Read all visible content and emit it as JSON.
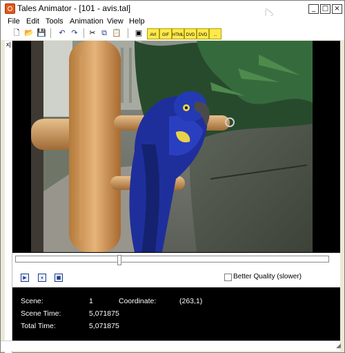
{
  "window": {
    "title": "Tales Animator - [101 - avis.tal]",
    "buttons": {
      "minimize": "_",
      "maximize": "□",
      "close": "×"
    }
  },
  "menu": {
    "items": [
      "File",
      "Edit",
      "Tools",
      "Animation",
      "View",
      "Help"
    ]
  },
  "toolbar": {
    "buttons": [
      {
        "name": "new",
        "icon": "new-file-icon",
        "glyph": "🗋"
      },
      {
        "name": "open",
        "icon": "open-folder-icon",
        "glyph": "📂"
      },
      {
        "name": "save",
        "icon": "save-icon",
        "glyph": "💾"
      },
      {
        "name": "undo",
        "icon": "undo-icon",
        "glyph": "↶"
      },
      {
        "name": "redo",
        "icon": "redo-icon",
        "glyph": "↷"
      },
      {
        "name": "cut",
        "icon": "cut-icon",
        "glyph": "✂"
      },
      {
        "name": "copy",
        "icon": "copy-icon",
        "glyph": "⧉"
      },
      {
        "name": "paste",
        "icon": "paste-icon",
        "glyph": "📋"
      },
      {
        "name": "frame",
        "icon": "frame-icon",
        "glyph": "▣"
      }
    ],
    "export_buttons": [
      "AVI",
      "GIF",
      "HTML",
      "DVD",
      "DVD",
      "..."
    ]
  },
  "left_panel": {
    "close": "x|"
  },
  "controls": {
    "play": "▶",
    "pause": "⏸",
    "stop": "■",
    "checkbox_label": "Better Quality (slower)",
    "slider_position_fraction": 0.33
  },
  "info": {
    "scene_label": "Scene:",
    "scene_value": "1",
    "coordinate_label": "Coordinate:",
    "coordinate_value": "(263,1)",
    "scene_time_label": "Scene Time:",
    "scene_time_value": "5,071875",
    "total_time_label": "Total Time:",
    "total_time_value": "5,071875"
  },
  "colors": {
    "accent": "#1f3c88",
    "parrot_blue": "#1e2f9c",
    "parrot_yellow": "#e8d24a"
  }
}
